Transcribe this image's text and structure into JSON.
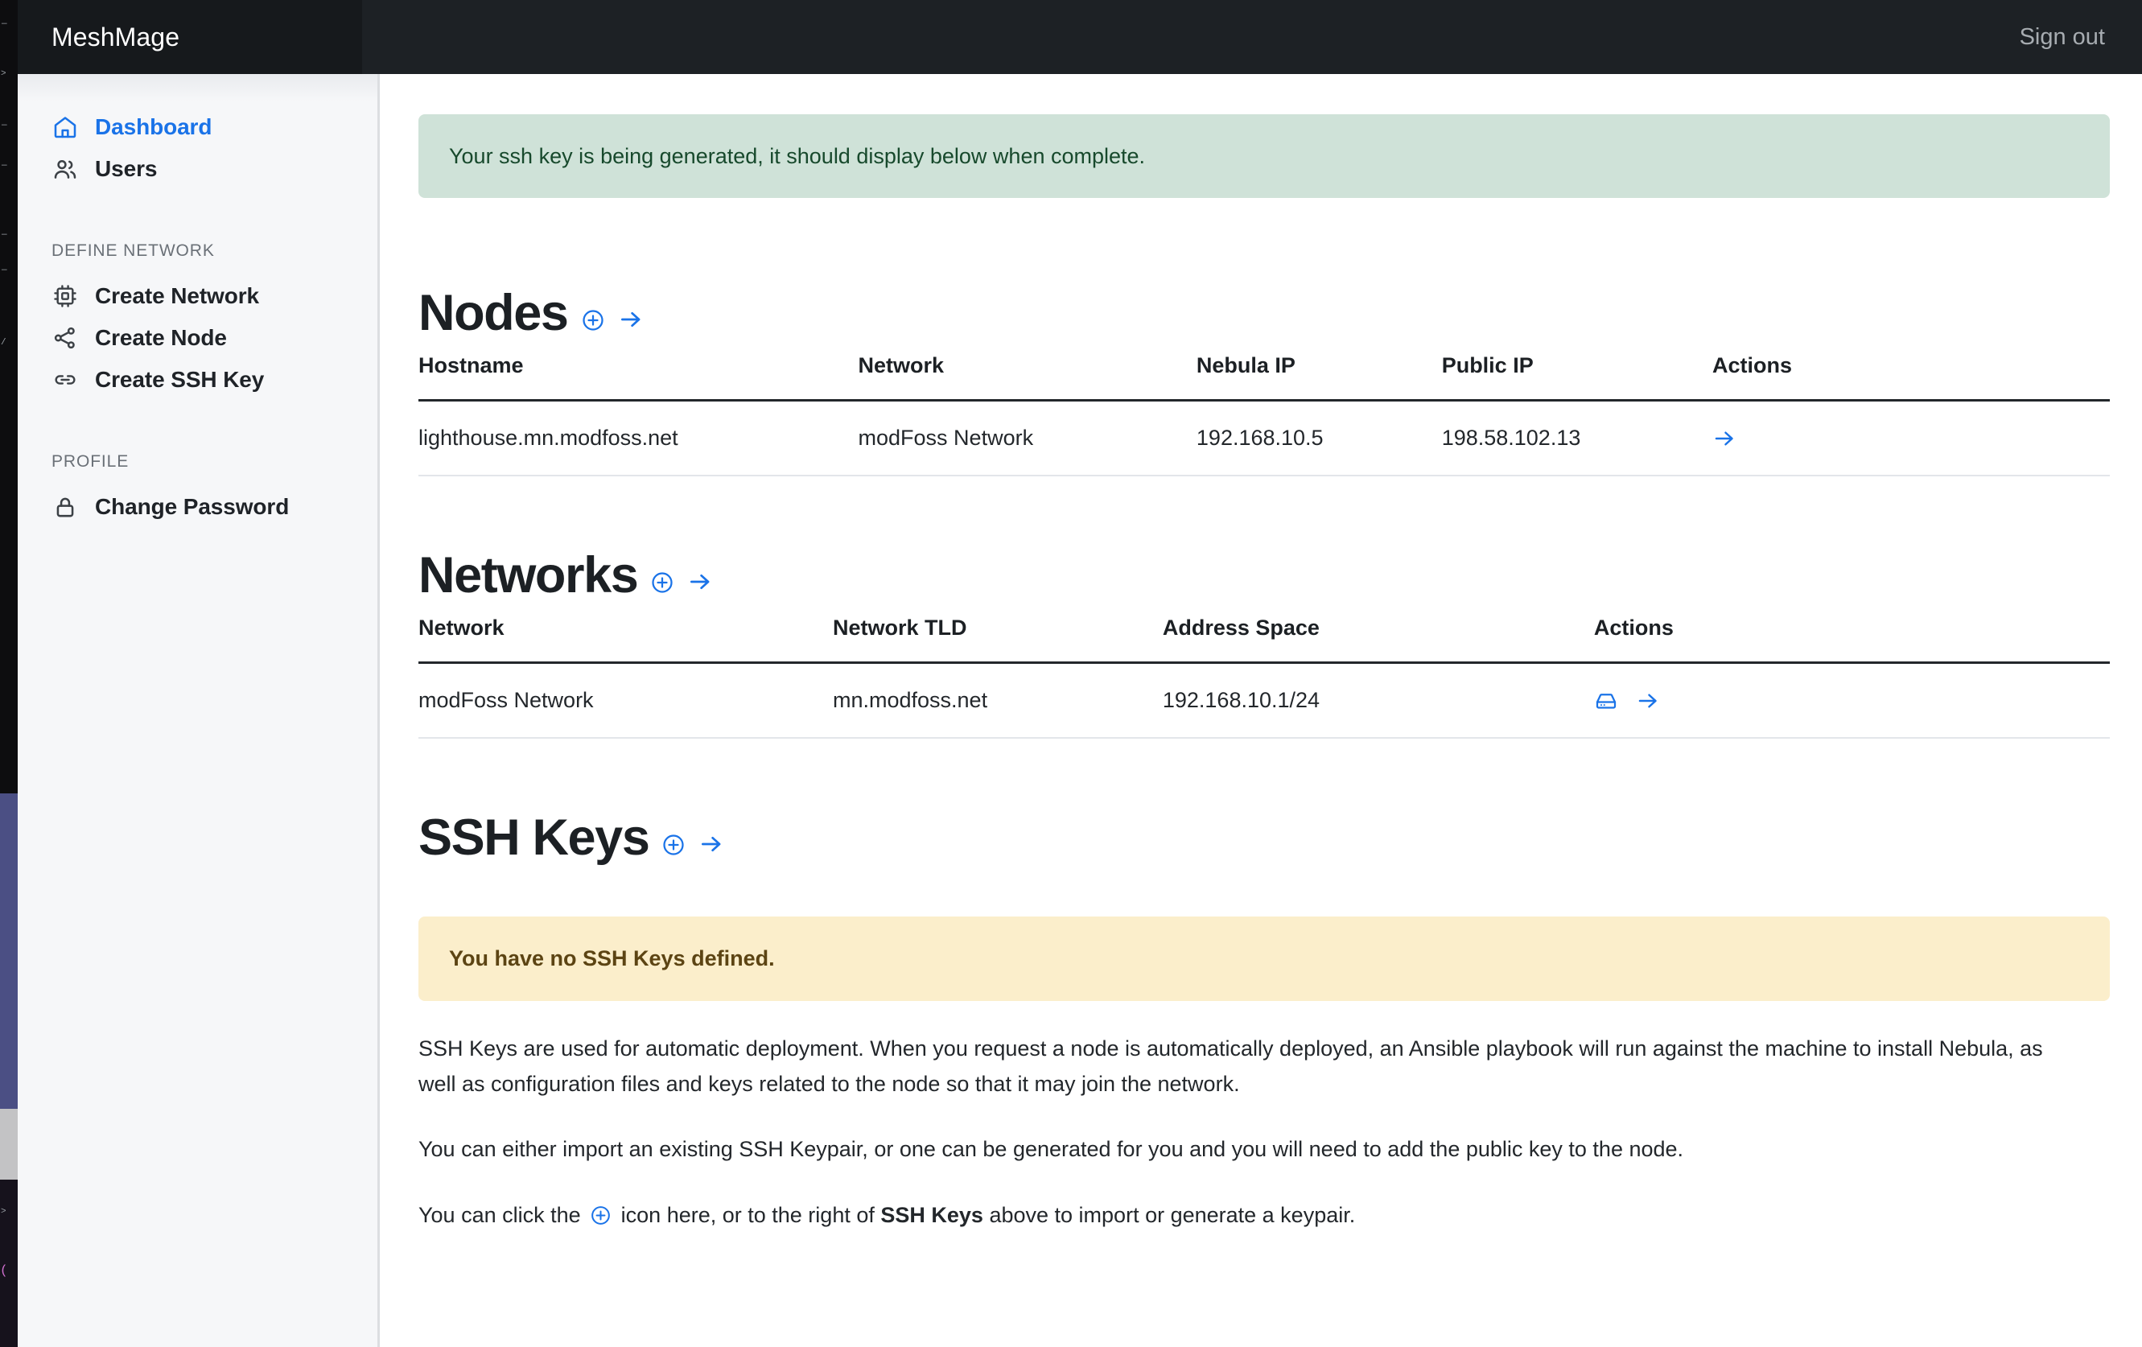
{
  "topbar": {
    "brand": "MeshMage",
    "signout_label": "Sign out"
  },
  "sidebar": {
    "items": [
      {
        "label": "Dashboard",
        "icon": "home-icon",
        "active": true
      },
      {
        "label": "Users",
        "icon": "users-icon",
        "active": false
      }
    ],
    "sections": [
      {
        "heading": "DEFINE NETWORK",
        "items": [
          {
            "label": "Create Network",
            "icon": "cpu-icon"
          },
          {
            "label": "Create Node",
            "icon": "share-nodes-icon"
          },
          {
            "label": "Create SSH Key",
            "icon": "link-icon"
          }
        ]
      },
      {
        "heading": "PROFILE",
        "items": [
          {
            "label": "Change Password",
            "icon": "lock-icon"
          }
        ]
      }
    ]
  },
  "main": {
    "alert_success": "Your ssh key is being generated, it should display below when complete.",
    "nodes": {
      "title": "Nodes",
      "add_label": "plus-circle-icon",
      "go_label": "arrow-right-icon",
      "columns": [
        "Hostname",
        "Network",
        "Nebula IP",
        "Public IP",
        "Actions"
      ],
      "rows": [
        {
          "hostname": "lighthouse.mn.modfoss.net",
          "network": "modFoss Network",
          "nebula_ip": "192.168.10.5",
          "public_ip": "198.58.102.13"
        }
      ]
    },
    "networks": {
      "title": "Networks",
      "columns": [
        "Network",
        "Network TLD",
        "Address Space",
        "Actions"
      ],
      "rows": [
        {
          "network": "modFoss Network",
          "tld": "mn.modfoss.net",
          "address_space": "192.168.10.1/24"
        }
      ]
    },
    "ssh_keys": {
      "title": "SSH Keys",
      "alert_warning": "You have no SSH Keys defined.",
      "paragraph_1": "SSH Keys are used for automatic deployment. When you request a node is automatically deployed, an Ansible playbook will run against the machine to install Nebula, as well as configuration files and keys related to the node so that it may join the network.",
      "paragraph_2": "You can either import an existing SSH Keypair, or one can be generated for you and you will need to add the public key to the node.",
      "paragraph_3_a": "You can click the",
      "paragraph_3_b": "icon here, or to the right of",
      "paragraph_3_bold": "SSH Keys",
      "paragraph_3_c": "above to import or generate a keypair."
    }
  },
  "colors": {
    "accent": "#1a73e8",
    "topbar_bg": "#1d2125",
    "sidebar_bg": "#f6f7f9",
    "success_bg": "#cfe2d8",
    "success_fg": "#17492c",
    "warning_bg": "#fbeecb",
    "warning_fg": "#5c4413"
  }
}
